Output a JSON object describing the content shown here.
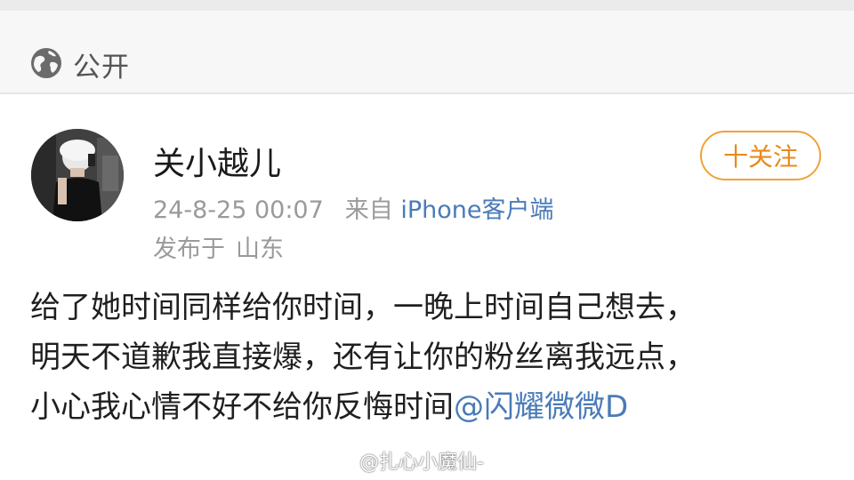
{
  "privacy": {
    "icon": "globe-icon",
    "label": "公开"
  },
  "post": {
    "username": "关小越儿",
    "timestamp": "24-8-25 00:07",
    "source_label": "来自",
    "client": "iPhone客户端",
    "location_label": "发布于",
    "location": "山东",
    "follow_button": {
      "icon": "plus-icon",
      "label": "十关注"
    },
    "text_lines": [
      "给了她时间同样给你时间，一晚上时间自己想去，",
      "明天不道歉我直接爆，还有让你的粉丝离我远点，",
      "小心我心情不好不给你反悔时间"
    ],
    "mention": "@闪耀微微D"
  },
  "watermark": {
    "icon": "weibo-logo-icon",
    "text": "@扎心小魔仙-"
  },
  "colors": {
    "link": "#4a7bb8",
    "follow": "#e88a1a",
    "meta": "#9a9a9a",
    "background": "#ffffff"
  }
}
